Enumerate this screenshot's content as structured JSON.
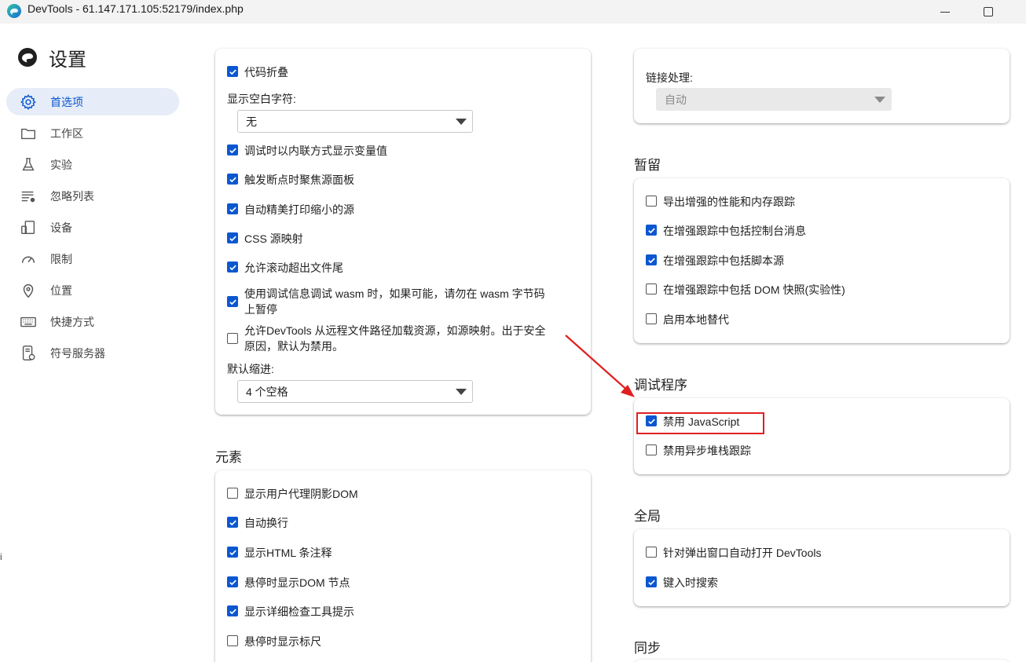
{
  "window": {
    "title": "DevTools - 61.147.171.105:52179/index.php"
  },
  "settings": {
    "heading": "设置"
  },
  "sidebar": {
    "items": [
      {
        "label": "首选项",
        "icon": "gear-icon",
        "active": true
      },
      {
        "label": "工作区",
        "icon": "folder-icon",
        "active": false
      },
      {
        "label": "实验",
        "icon": "flask-icon",
        "active": false
      },
      {
        "label": "忽略列表",
        "icon": "ignore-list-icon",
        "active": false
      },
      {
        "label": "设备",
        "icon": "devices-icon",
        "active": false
      },
      {
        "label": "限制",
        "icon": "throttle-gauge-icon",
        "active": false
      },
      {
        "label": "位置",
        "icon": "location-pin-icon",
        "active": false
      },
      {
        "label": "快捷方式",
        "icon": "keyboard-icon",
        "active": false
      },
      {
        "label": "符号服务器",
        "icon": "symbol-server-icon",
        "active": false
      }
    ]
  },
  "left": {
    "sources_card": {
      "code_folding": {
        "label": "代码折叠",
        "checked": true
      },
      "whitespace": {
        "label": "显示空白字符:",
        "value": "无"
      },
      "inline_values": {
        "label": "调试时以内联方式显示变量值",
        "checked": true
      },
      "focus_sources": {
        "label": "触发断点时聚焦源面板",
        "checked": true
      },
      "pretty_print": {
        "label": "自动精美打印缩小的源",
        "checked": true
      },
      "css_sourcemaps": {
        "label": "CSS 源映射",
        "checked": true
      },
      "scroll_past_end": {
        "label": "允许滚动超出文件尾",
        "checked": true
      },
      "wasm_pause": {
        "label_line1": "使用调试信息调试 wasm 时，如果可能，请勿在 wasm 字节码",
        "label_line2": "上暂停",
        "checked": true
      },
      "remote_load": {
        "label_line1": "允许DevTools 从远程文件路径加载资源，如源映射。出于安全",
        "label_line2": "原因，默认为禁用。",
        "checked": false
      },
      "indent": {
        "label": "默认缩进:",
        "value": "4 个空格"
      }
    },
    "elements_section": {
      "title": "元素",
      "items": [
        {
          "label": "显示用户代理阴影DOM",
          "checked": false
        },
        {
          "label": "自动换行",
          "checked": true
        },
        {
          "label": "显示HTML 条注释",
          "checked": true
        },
        {
          "label": "悬停时显示DOM 节点",
          "checked": true
        },
        {
          "label": "显示详细检查工具提示",
          "checked": true
        },
        {
          "label": "悬停时显示标尺",
          "checked": false
        }
      ]
    }
  },
  "right": {
    "link_handling": {
      "label": "链接处理:",
      "value": "自动"
    },
    "persistence": {
      "title": "暂留",
      "items": [
        {
          "label": "导出增强的性能和内存跟踪",
          "checked": false
        },
        {
          "label": "在增强跟踪中包括控制台消息",
          "checked": true
        },
        {
          "label": "在增强跟踪中包括脚本源",
          "checked": true
        },
        {
          "label": "在增强跟踪中包括 DOM 快照(实验性)",
          "checked": false
        },
        {
          "label": "启用本地替代",
          "checked": false
        }
      ]
    },
    "debugger": {
      "title": "调试程序",
      "items": [
        {
          "label": "禁用 JavaScript",
          "checked": true
        },
        {
          "label": "禁用异步堆栈跟踪",
          "checked": false
        }
      ]
    },
    "global": {
      "title": "全局",
      "items": [
        {
          "label": "针对弹出窗口自动打开 DevTools",
          "checked": false
        },
        {
          "label": "键入时搜索",
          "checked": true
        }
      ]
    },
    "sync": {
      "title": "同步"
    }
  },
  "edge_glyph": "i",
  "colors": {
    "accent": "#0b57d0",
    "active_nav_bg": "#e6edf8",
    "annotation_red": "#e02020"
  }
}
